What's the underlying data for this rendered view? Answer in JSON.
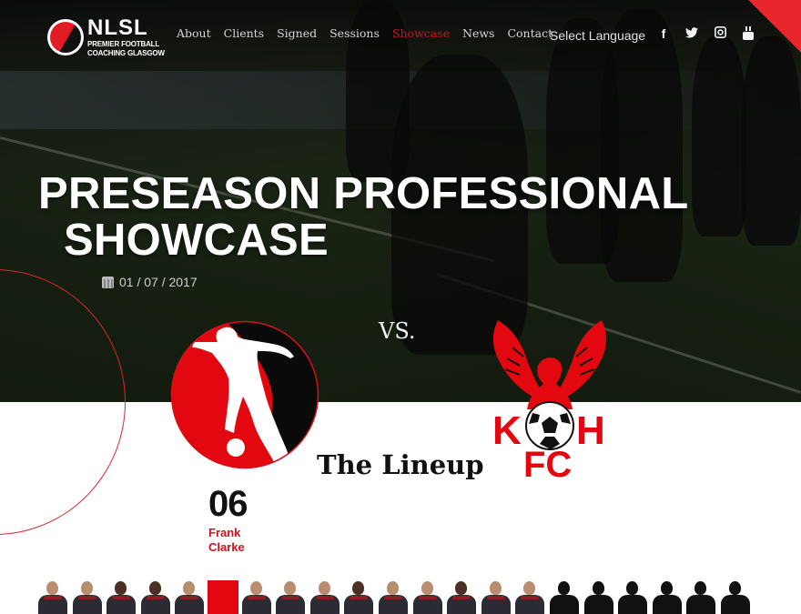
{
  "brand": {
    "name": "NLSL",
    "tagline_line1": "PREMIER FOOTBALL",
    "tagline_line2": "COACHING GLASGOW",
    "accent_color": "#d4121b"
  },
  "nav": {
    "items": [
      {
        "label": "About",
        "active": false
      },
      {
        "label": "Clients",
        "active": false
      },
      {
        "label": "Signed",
        "active": false
      },
      {
        "label": "Sessions",
        "active": false
      },
      {
        "label": "Showcase",
        "active": true
      },
      {
        "label": "News",
        "active": false
      },
      {
        "label": "Contact",
        "active": false
      }
    ],
    "language_label": "Select Language",
    "social": [
      {
        "icon": "facebook-icon",
        "glyph": "f"
      },
      {
        "icon": "twitter-icon",
        "glyph": "🐦"
      },
      {
        "icon": "instagram-icon",
        "glyph": "◘"
      },
      {
        "icon": "youtube-icon",
        "glyph": "▣"
      }
    ]
  },
  "event": {
    "title_line1": "PRESEASON PROFESSIONAL",
    "title_line2": "SHOWCASE",
    "date": "01 / 07 / 2017",
    "date_icon": "calendar-icon",
    "vs_label": "VS.",
    "home_team_logo": "nlsl-crest",
    "away_team_logo": "kh-fc-crest",
    "away_team_text_top_left": "K",
    "away_team_text_top_right": "H",
    "away_team_text_bottom": "FC"
  },
  "lineup": {
    "heading": "The Lineup",
    "featured_player": {
      "number": "06",
      "first_name": "Frank",
      "last_name": "Clarke"
    },
    "squad": [
      {
        "type": "photo"
      },
      {
        "type": "photo"
      },
      {
        "type": "photo-dark"
      },
      {
        "type": "photo-dark"
      },
      {
        "type": "photo"
      },
      {
        "type": "selected"
      },
      {
        "type": "photo"
      },
      {
        "type": "photo"
      },
      {
        "type": "photo"
      },
      {
        "type": "photo-dark"
      },
      {
        "type": "photo"
      },
      {
        "type": "photo"
      },
      {
        "type": "photo-dark"
      },
      {
        "type": "photo"
      },
      {
        "type": "photo"
      },
      {
        "type": "silhouette"
      },
      {
        "type": "silhouette"
      },
      {
        "type": "silhouette"
      },
      {
        "type": "silhouette"
      },
      {
        "type": "silhouette"
      },
      {
        "type": "silhouette"
      }
    ]
  }
}
